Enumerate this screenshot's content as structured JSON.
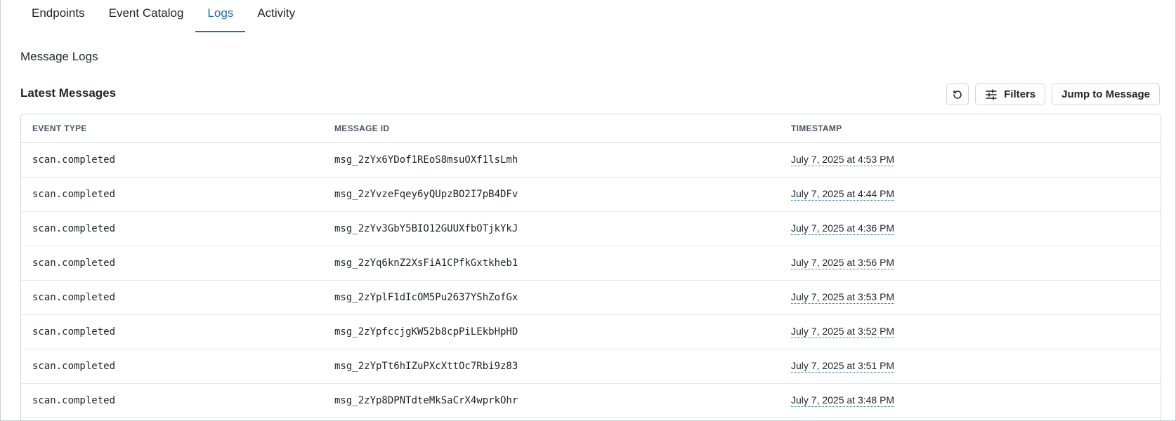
{
  "tabs": [
    {
      "label": "Endpoints",
      "active": false
    },
    {
      "label": "Event Catalog",
      "active": false
    },
    {
      "label": "Logs",
      "active": true
    },
    {
      "label": "Activity",
      "active": false
    }
  ],
  "page_title": "Message Logs",
  "section_title": "Latest Messages",
  "toolbar": {
    "refresh_icon": "refresh-icon",
    "filters_label": "Filters",
    "filters_icon": "sliders-icon",
    "jump_label": "Jump to Message"
  },
  "table": {
    "columns": [
      "EVENT TYPE",
      "MESSAGE ID",
      "TIMESTAMP"
    ],
    "rows": [
      {
        "event_type": "scan.completed",
        "message_id": "msg_2zYx6YDof1REoS8msuOXf1lsLmh",
        "timestamp": "July 7, 2025 at 4:53 PM"
      },
      {
        "event_type": "scan.completed",
        "message_id": "msg_2zYvzeFqey6yQUpzBO2I7pB4DFv",
        "timestamp": "July 7, 2025 at 4:44 PM"
      },
      {
        "event_type": "scan.completed",
        "message_id": "msg_2zYv3GbY5BIO12GUUXfbOTjkYkJ",
        "timestamp": "July 7, 2025 at 4:36 PM"
      },
      {
        "event_type": "scan.completed",
        "message_id": "msg_2zYq6knZ2XsFiA1CPfkGxtkheb1",
        "timestamp": "July 7, 2025 at 3:56 PM"
      },
      {
        "event_type": "scan.completed",
        "message_id": "msg_2zYplF1dIcOM5Pu2637YShZofGx",
        "timestamp": "July 7, 2025 at 3:53 PM"
      },
      {
        "event_type": "scan.completed",
        "message_id": "msg_2zYpfccjgKW52b8cpPiLEkbHpHD",
        "timestamp": "July 7, 2025 at 3:52 PM"
      },
      {
        "event_type": "scan.completed",
        "message_id": "msg_2zYpTt6hIZuPXcXttOc7Rbi9z83",
        "timestamp": "July 7, 2025 at 3:51 PM"
      },
      {
        "event_type": "scan.completed",
        "message_id": "msg_2zYp8DPNTdteMkSaCrX4wprkOhr",
        "timestamp": "July 7, 2025 at 3:48 PM"
      }
    ]
  },
  "colors": {
    "accent": "#1b6fb4",
    "border": "#d6d9dd"
  }
}
